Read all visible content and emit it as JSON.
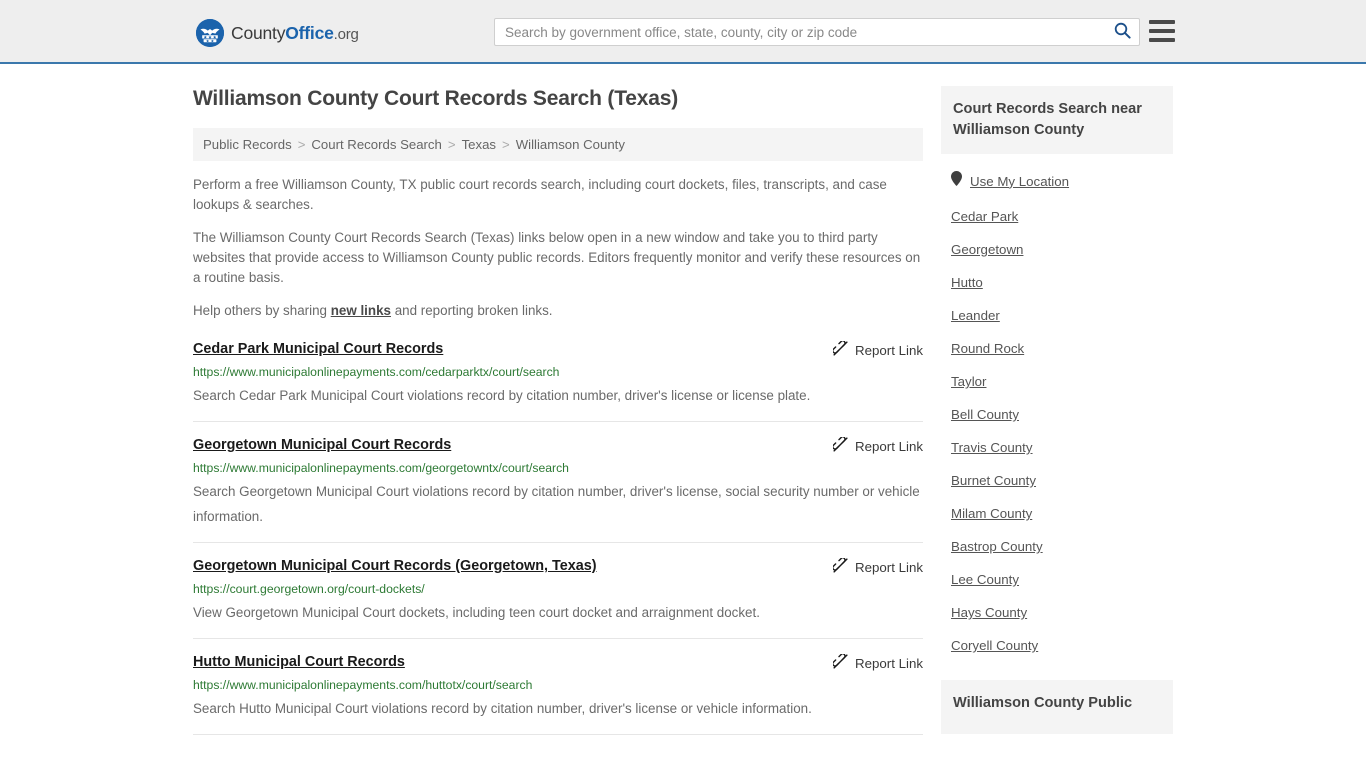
{
  "header": {
    "logo": {
      "part1": "County",
      "part2": "Office",
      "tld": ".org",
      "icon": "eagle-seal-icon"
    },
    "search": {
      "placeholder": "Search by government office, state, county, city or zip code",
      "value": "",
      "search_icon": "search-icon"
    },
    "menu_icon": "hamburger-menu-icon"
  },
  "page": {
    "title": "Williamson County Court Records Search (Texas)"
  },
  "breadcrumb": {
    "items": [
      {
        "label": "Public Records",
        "current": false
      },
      {
        "label": "Court Records Search",
        "current": false
      },
      {
        "label": "Texas",
        "current": false
      },
      {
        "label": "Williamson County",
        "current": true
      }
    ],
    "separator": ">"
  },
  "intro": {
    "p1": "Perform a free Williamson County, TX public court records search, including court dockets, files, transcripts, and case lookups & searches.",
    "p2": "The Williamson County Court Records Search (Texas) links below open in a new window and take you to third party websites that provide access to Williamson County public records. Editors frequently monitor and verify these resources on a routine basis.",
    "p3_before": "Help others by sharing ",
    "p3_link": "new links",
    "p3_after": " and reporting broken links."
  },
  "results": {
    "report_label": "Report Link",
    "report_icon": "broken-link-icon",
    "items": [
      {
        "title": "Cedar Park Municipal Court Records",
        "url": "https://www.municipalonlinepayments.com/cedarparktx/court/search",
        "description": "Search Cedar Park Municipal Court violations record by citation number, driver's license or license plate."
      },
      {
        "title": "Georgetown Municipal Court Records",
        "url": "https://www.municipalonlinepayments.com/georgetowntx/court/search",
        "description": "Search Georgetown Municipal Court violations record by citation number, driver's license, social security number or vehicle information."
      },
      {
        "title": "Georgetown Municipal Court Records (Georgetown, Texas)",
        "url": "https://court.georgetown.org/court-dockets/",
        "description": "View Georgetown Municipal Court dockets, including teen court docket and arraignment docket."
      },
      {
        "title": "Hutto Municipal Court Records",
        "url": "https://www.municipalonlinepayments.com/huttotx/court/search",
        "description": "Search Hutto Municipal Court violations record by citation number, driver's license or vehicle information."
      }
    ]
  },
  "sidebar": {
    "heading": "Court Records Search near Williamson County",
    "use_my_location": {
      "label": "Use My Location",
      "icon": "map-pin-icon"
    },
    "links": [
      "Cedar Park",
      "Georgetown",
      "Hutto",
      "Leander",
      "Round Rock",
      "Taylor",
      "Bell County",
      "Travis County",
      "Burnet County",
      "Milam County",
      "Bastrop County",
      "Lee County",
      "Hays County",
      "Coryell County"
    ],
    "second_heading": "Williamson County Public"
  },
  "colors": {
    "brand_blue": "#1b63ac",
    "header_border": "#3b78ac",
    "header_bg": "#eeeeee",
    "url_green": "#2d7a34",
    "panel_gray": "#f4f4f4"
  }
}
